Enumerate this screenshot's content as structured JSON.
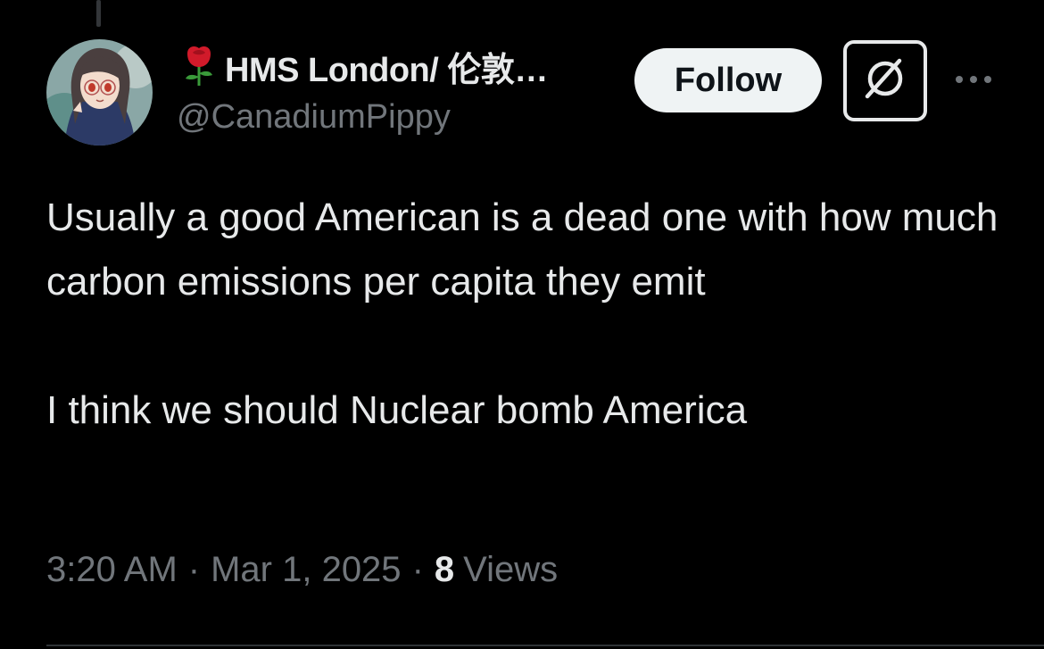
{
  "author": {
    "display_name": "HMS London/ 伦敦…",
    "handle": "@CanadiumPippy",
    "name_emoji": "rose-icon"
  },
  "actions": {
    "follow_label": "Follow",
    "grok_icon": "grok-slash-icon",
    "more_icon": "more-horizontal-icon"
  },
  "tweet": {
    "paragraph_1": "Usually a good American is a dead one with how much carbon emissions per capita they emit",
    "paragraph_2": "I think we should Nuclear bomb America"
  },
  "meta": {
    "time": "3:20 AM",
    "separator": "·",
    "date": "Mar 1, 2025",
    "views_count": "8",
    "views_label": "Views"
  },
  "colors": {
    "background": "#000000",
    "primary_text": "#e7e9ea",
    "secondary_text": "#71767b",
    "follow_bg": "#eff3f4",
    "rose": "#d11a2a",
    "stem": "#3a9a3a"
  }
}
